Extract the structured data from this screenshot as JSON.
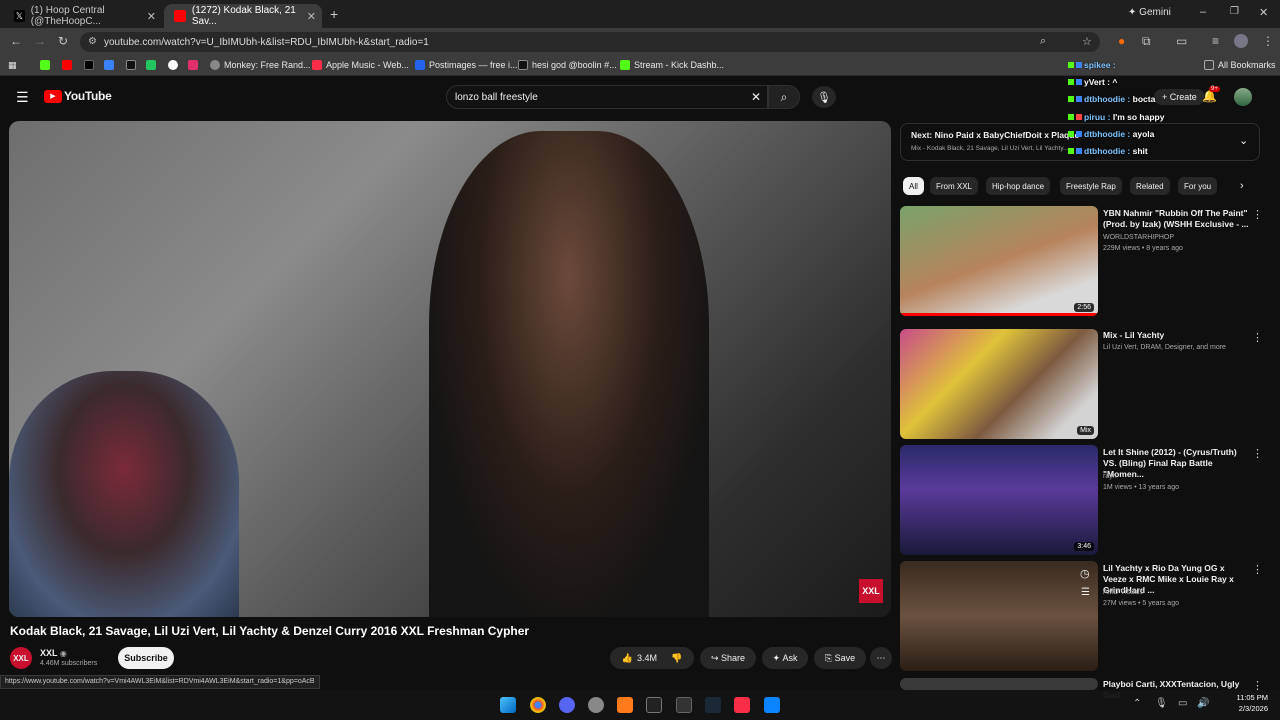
{
  "browser": {
    "tabs": [
      {
        "label": "(1) Hoop Central (@TheHoopC..."
      },
      {
        "label": "(1272) Kodak Black, 21 Sav..."
      }
    ],
    "gemini_label": "Gemini",
    "url": "youtube.com/watch?v=U_IbIMUbh-k&list=RDU_IbIMUbh-k&start_radio=1",
    "bookmarks": [
      "Monkey: Free Rand...",
      "Apple Music - Web...",
      "Postimages — free i...",
      "hesi god @boolin #...",
      "Stream - Kick Dashb..."
    ],
    "all_bookmarks": "All Bookmarks",
    "status_url": "https://www.youtube.com/watch?v=Vmi4AWL3EiM&list=RDVmi4AWL3EiM&start_radio=1&pp=oAcB"
  },
  "youtube": {
    "logo_text": "YouTube",
    "search_value": "lonzo ball freestyle",
    "create_label": "Create",
    "notif_count": "9+",
    "video_title": "Kodak Black, 21 Savage, Lil Uzi Vert, Lil Yachty & Denzel Curry 2016 XXL Freshman Cypher",
    "watermark": "XXL",
    "channel": {
      "name": "XXL",
      "subs": "4.46M subscribers",
      "avatar_text": "XXL"
    },
    "subscribe_label": "Subscribe",
    "actions": {
      "likes": "3.4M",
      "share": "Share",
      "ask": "Ask",
      "save": "Save"
    },
    "next_label": "Next:",
    "next_title": "Nino Paid x BabyChiefDoit x Plaque",
    "next_sub": "Mix - Kodak Black, 21 Savage, Lil Uzi Vert, Lil Yachty...",
    "chips": [
      "All",
      "From XXL",
      "Hip-hop dance",
      "Freestyle Rap",
      "Related",
      "For you"
    ],
    "recommendations": [
      {
        "title": "YBN Nahmir \"Rubbin Off The Paint\" (Prod. by Izak) (WSHH Exclusive - ...",
        "channel": "WORLDSTARHIPHOP",
        "meta": "229M views • 8 years ago",
        "duration": "2:56"
      },
      {
        "title": "Mix - Lil Yachty",
        "channel": "Lil Uzi Vert, DRAM, Designer, and more",
        "meta": "",
        "duration": "Mix"
      },
      {
        "title": "Let It Shine (2012) - (Cyrus/Truth) VS. (Bling) Final Rap Battle \"Momen...",
        "channel": "rayn",
        "meta": "1M views • 13 years ago",
        "duration": "3:46"
      },
      {
        "title": "Lil Yachty x Rio Da Yung OG x Veeze x RMC Mike x Louie Ray x GrindHard ...",
        "channel": "AMD Visuals",
        "meta": "27M views • 5 years ago",
        "duration": ""
      },
      {
        "title": "Playboi Carti, XXXTentacion, Ugly God",
        "channel": "",
        "meta": "",
        "duration": ""
      }
    ]
  },
  "chat_overlay": [
    {
      "user": "spikee :",
      "msg": ""
    },
    {
      "user": "yVert :",
      "msg": "^"
    },
    {
      "user": "dtbhoodie :",
      "msg": "bocta"
    },
    {
      "user": "piruu :",
      "msg": "I'm so happy"
    },
    {
      "user": "dtbhoodie :",
      "msg": "ayola"
    },
    {
      "user": "dtbhoodie :",
      "msg": "shit"
    }
  ],
  "taskbar": {
    "time": "11:05 PM",
    "date": "2/3/2026"
  },
  "colors": {
    "yt_red": "#ff0000",
    "bg": "#0f0f0f",
    "chrome_tab": "#3c3c3c"
  }
}
